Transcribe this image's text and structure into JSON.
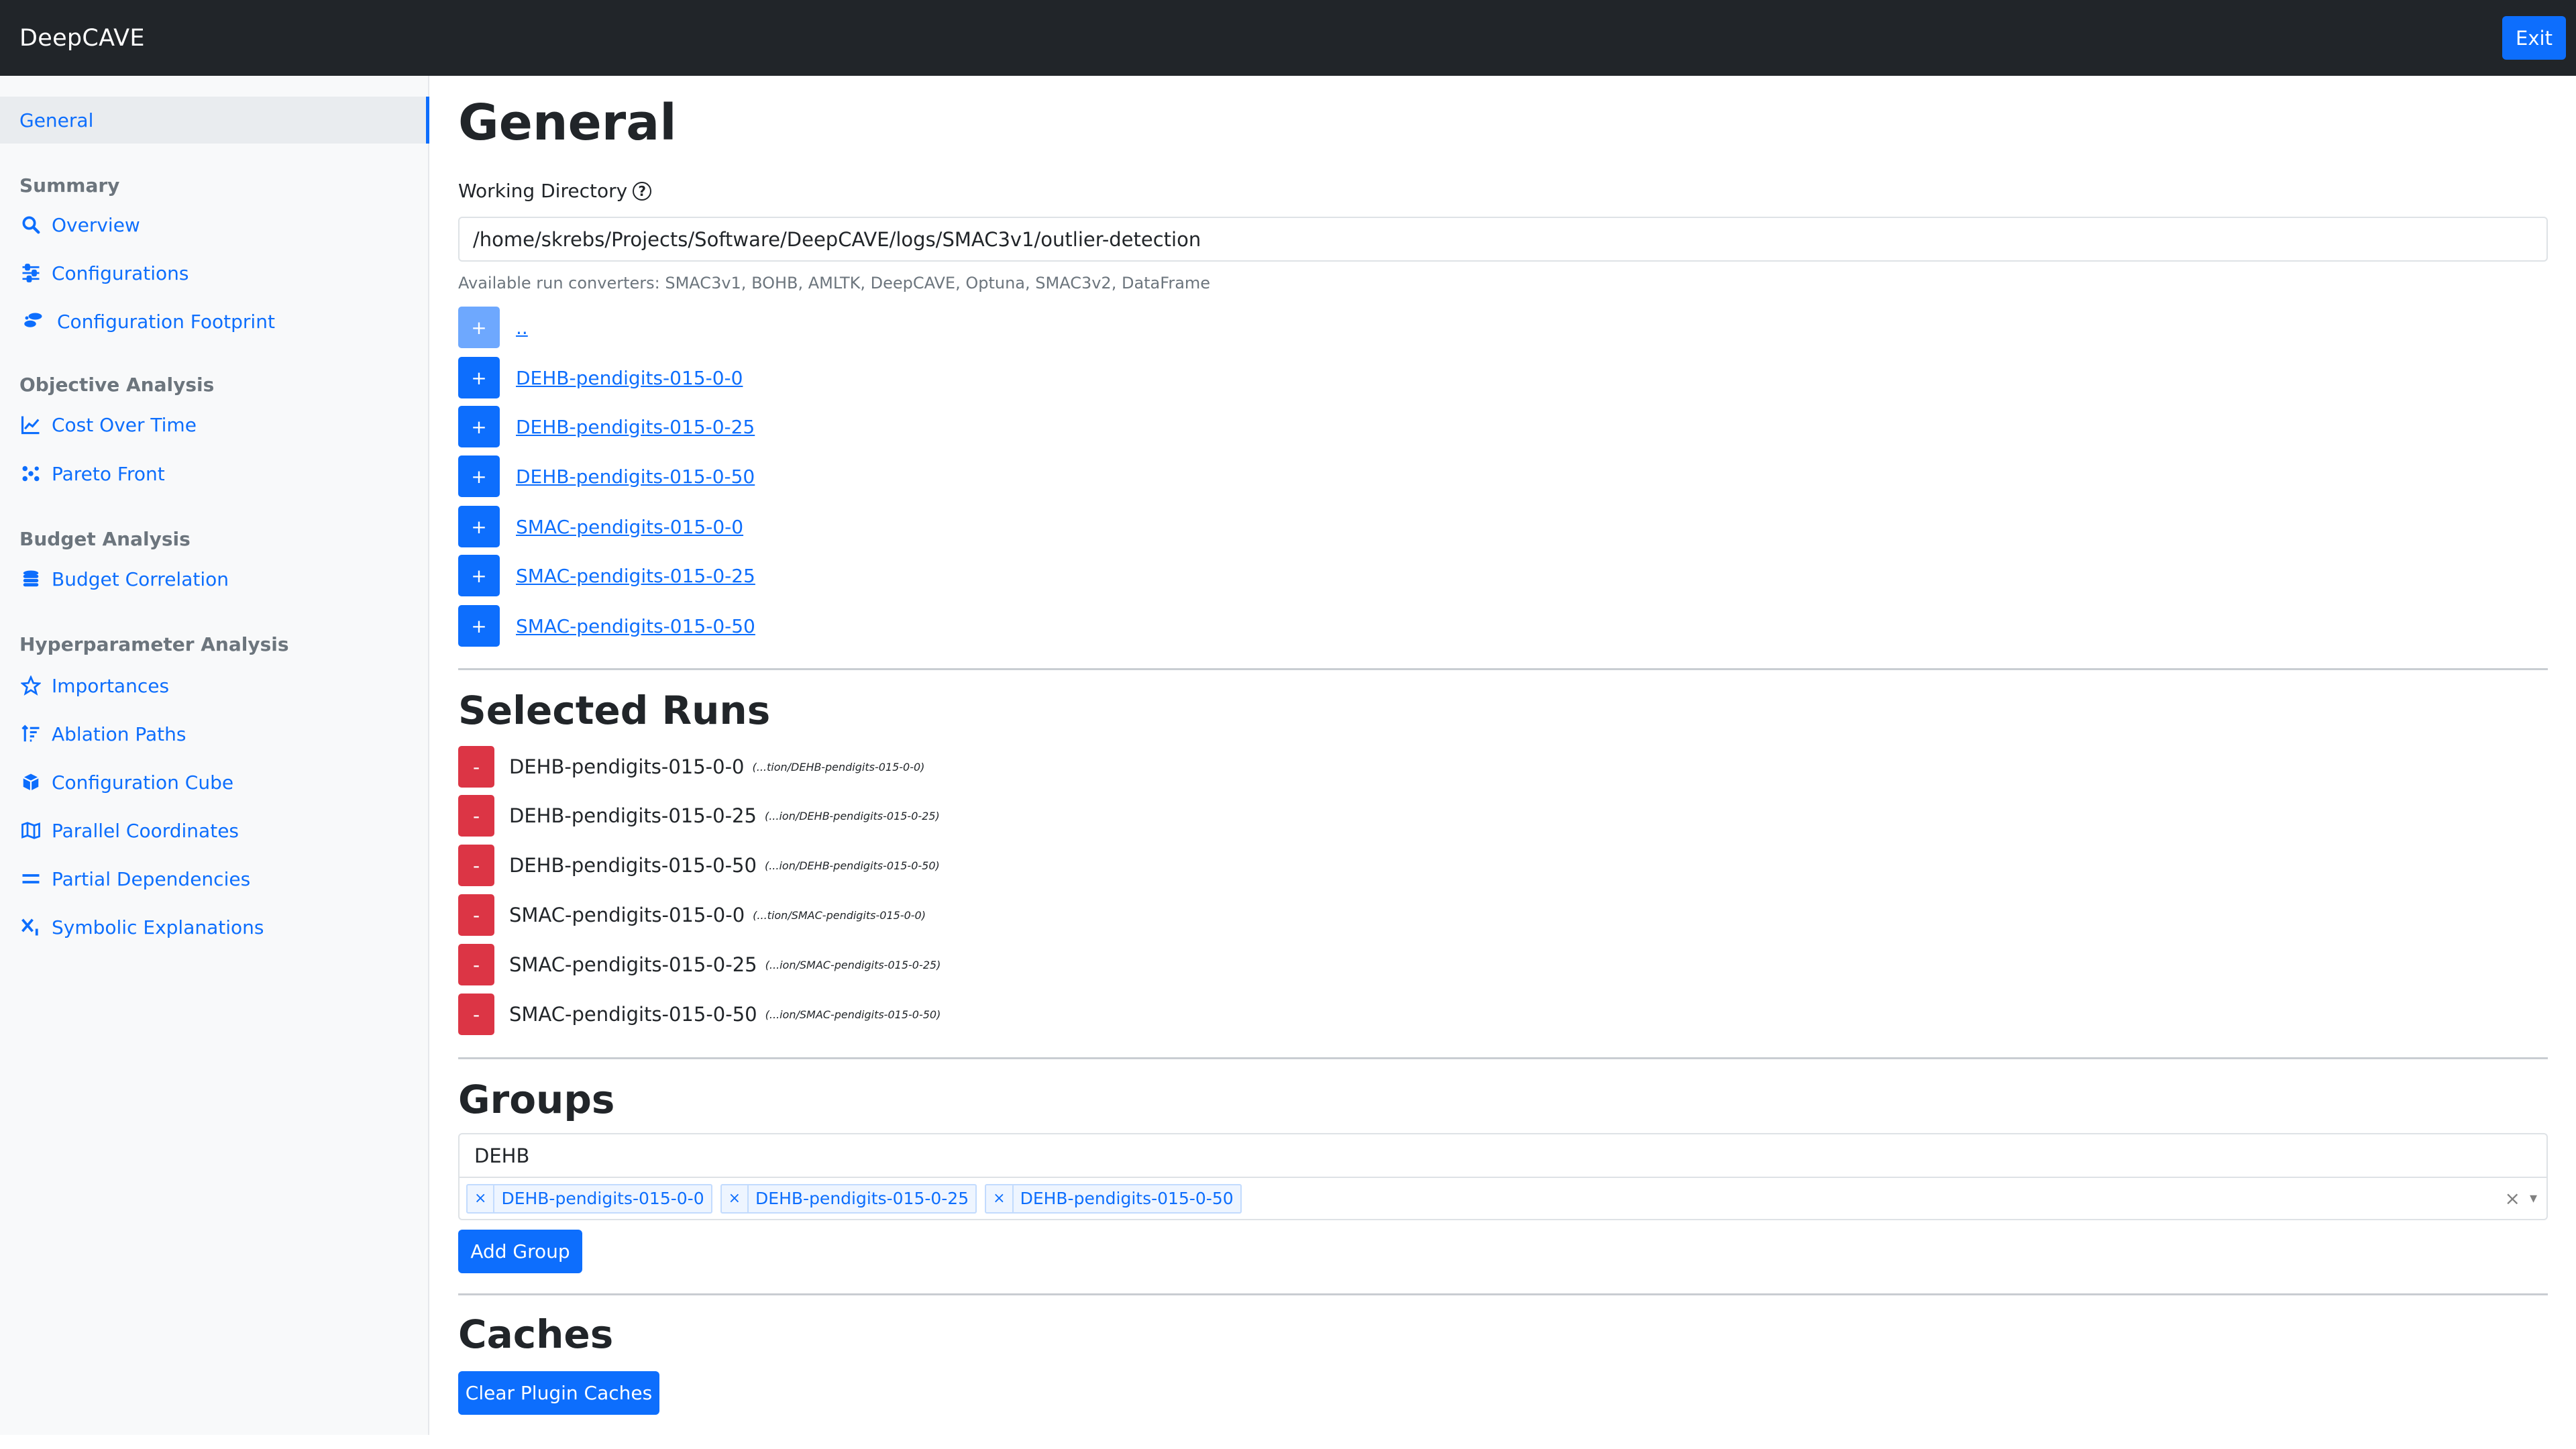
{
  "app": {
    "title": "DeepCAVE",
    "exit_label": "Exit"
  },
  "sidebar": {
    "active": "General",
    "sections": [
      {
        "heading": "Summary",
        "items": [
          {
            "label": "Overview",
            "icon": "search-icon"
          },
          {
            "label": "Configurations",
            "icon": "sliders-icon"
          },
          {
            "label": "Configuration Footprint",
            "icon": "footprint-icon"
          }
        ]
      },
      {
        "heading": "Objective Analysis",
        "items": [
          {
            "label": "Cost Over Time",
            "icon": "line-chart-icon"
          },
          {
            "label": "Pareto Front",
            "icon": "pareto-icon"
          }
        ]
      },
      {
        "heading": "Budget Analysis",
        "items": [
          {
            "label": "Budget Correlation",
            "icon": "coins-icon"
          }
        ]
      },
      {
        "heading": "Hyperparameter Analysis",
        "items": [
          {
            "label": "Importances",
            "icon": "star-icon"
          },
          {
            "label": "Ablation Paths",
            "icon": "sort-icon"
          },
          {
            "label": "Configuration Cube",
            "icon": "cube-icon"
          },
          {
            "label": "Parallel Coordinates",
            "icon": "map-icon"
          },
          {
            "label": "Partial Dependencies",
            "icon": "equals-icon"
          },
          {
            "label": "Symbolic Explanations",
            "icon": "subscript-icon"
          }
        ]
      }
    ]
  },
  "main": {
    "title": "General",
    "working_dir_label": "Working Directory",
    "working_dir_value": "/home/skrebs/Projects/Software/DeepCAVE/logs/SMAC3v1/outlier-detection",
    "converters_text": "Available run converters: SMAC3v1, BOHB, AMLTK, DeepCAVE, Optuna, SMAC3v2, DataFrame",
    "runs": [
      {
        "button": "+",
        "label": ".."
      },
      {
        "button": "+",
        "label": "DEHB-pendigits-015-0-0"
      },
      {
        "button": "+",
        "label": "DEHB-pendigits-015-0-25"
      },
      {
        "button": "+",
        "label": "DEHB-pendigits-015-0-50"
      },
      {
        "button": "+",
        "label": "SMAC-pendigits-015-0-0"
      },
      {
        "button": "+",
        "label": "SMAC-pendigits-015-0-25"
      },
      {
        "button": "+",
        "label": "SMAC-pendigits-015-0-50"
      }
    ],
    "selected_title": "Selected Runs",
    "selected": [
      {
        "button": "-",
        "name": "DEHB-pendigits-015-0-0",
        "path": "(...tion/DEHB-pendigits-015-0-0)"
      },
      {
        "button": "-",
        "name": "DEHB-pendigits-015-0-25",
        "path": "(...ion/DEHB-pendigits-015-0-25)"
      },
      {
        "button": "-",
        "name": "DEHB-pendigits-015-0-50",
        "path": "(...ion/DEHB-pendigits-015-0-50)"
      },
      {
        "button": "-",
        "name": "SMAC-pendigits-015-0-0",
        "path": "(...tion/SMAC-pendigits-015-0-0)"
      },
      {
        "button": "-",
        "name": "SMAC-pendigits-015-0-25",
        "path": "(...ion/SMAC-pendigits-015-0-25)"
      },
      {
        "button": "-",
        "name": "SMAC-pendigits-015-0-50",
        "path": "(...ion/SMAC-pendigits-015-0-50)"
      }
    ],
    "groups_title": "Groups",
    "group_name": "DEHB",
    "group_chips": [
      {
        "remove": "×",
        "label": "DEHB-pendigits-015-0-0"
      },
      {
        "remove": "×",
        "label": "DEHB-pendigits-015-0-25"
      },
      {
        "remove": "×",
        "label": "DEHB-pendigits-015-0-50"
      }
    ],
    "select_clear": "×",
    "select_dropdown": "▾",
    "add_group_label": "Add Group",
    "caches_title": "Caches",
    "clear_caches_label": "Clear Plugin Caches"
  },
  "colors": {
    "primary": "#0d6efd",
    "danger": "#dc3545",
    "navbar": "#212529",
    "sidebar": "#f8f9fa"
  }
}
